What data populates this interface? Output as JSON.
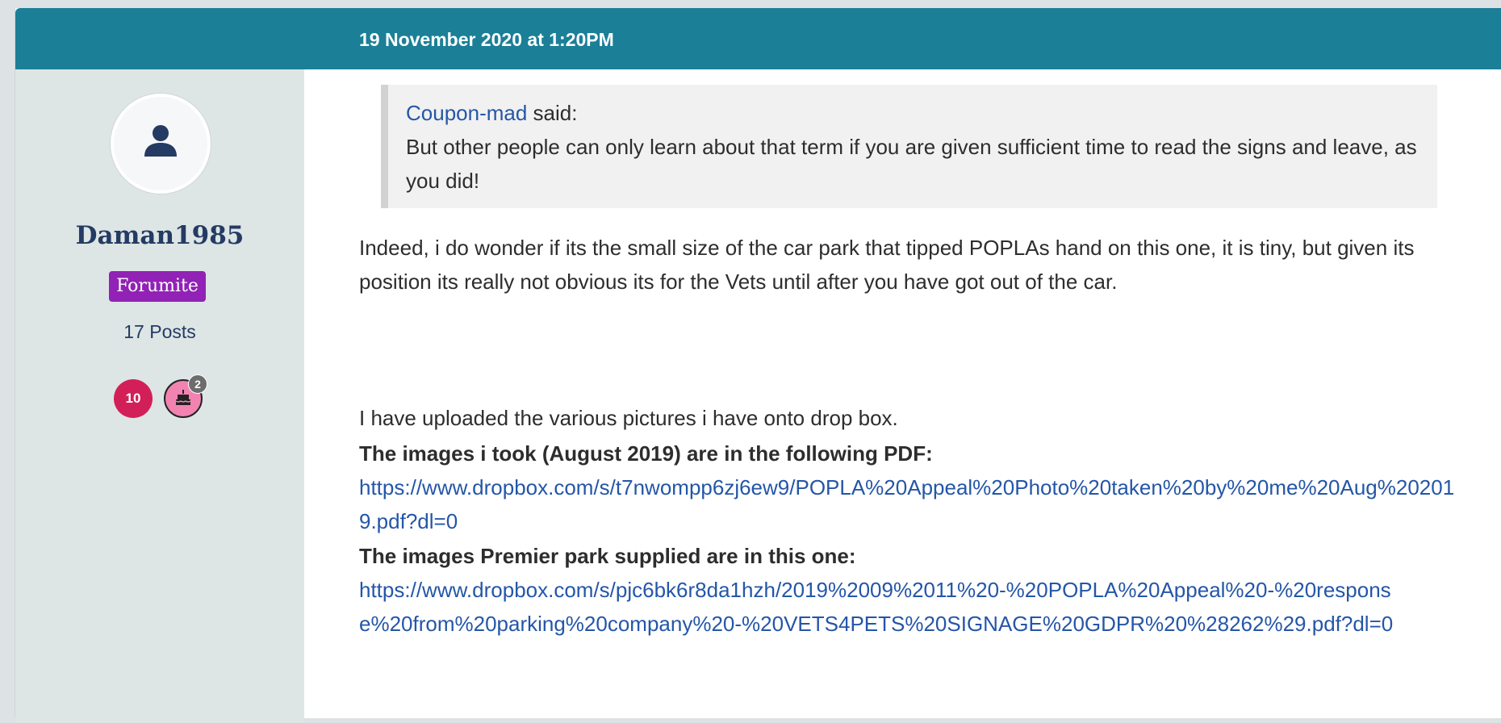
{
  "post": {
    "date": "19 November 2020 at 1:20PM"
  },
  "user": {
    "username": "Daman1985",
    "role": "Forumite",
    "post_count": "17 Posts",
    "awards": [
      {
        "label": "10",
        "color": "#d21f57"
      },
      {
        "icon": "cake-icon",
        "count": "2",
        "color": "#f283b0"
      }
    ]
  },
  "quote": {
    "author": "Coupon-mad",
    "said": " said:",
    "text": "But other people can only learn about that term if you are given sufficient time to read the signs and leave, as you did!"
  },
  "body": {
    "paragraph1": "Indeed, i do wonder if its the small size of the car park that tipped POPLAs hand on this one, it is tiny, but given its position its really not obvious its for the Vets until after you have got out of the car.",
    "upload_line": "I have uploaded the various pictures i have onto drop box.",
    "pdf1_label": "The images i took (August 2019) are in the following PDF:",
    "pdf1_link": "https://www.dropbox.com/s/t7nwompp6zj6ew9/POPLA%20Appeal%20Photo%20taken%20by%20me%20Aug%202019.pdf?dl=0",
    "pdf2_label": "The images Premier park supplied are in this one:",
    "pdf2_link": "https://www.dropbox.com/s/pjc6bk6r8da1hzh/2019%2009%2011%20-%20POPLA%20Appeal%20-%20response%20from%20parking%20company%20-%20VETS4PETS%20SIGNAGE%20GDPR%20%28262%29.pdf?dl=0"
  },
  "colors": {
    "header": "#1b7f97",
    "sidebar": "#dde5e5",
    "role_badge": "#9122b5",
    "link": "#2456a8"
  }
}
